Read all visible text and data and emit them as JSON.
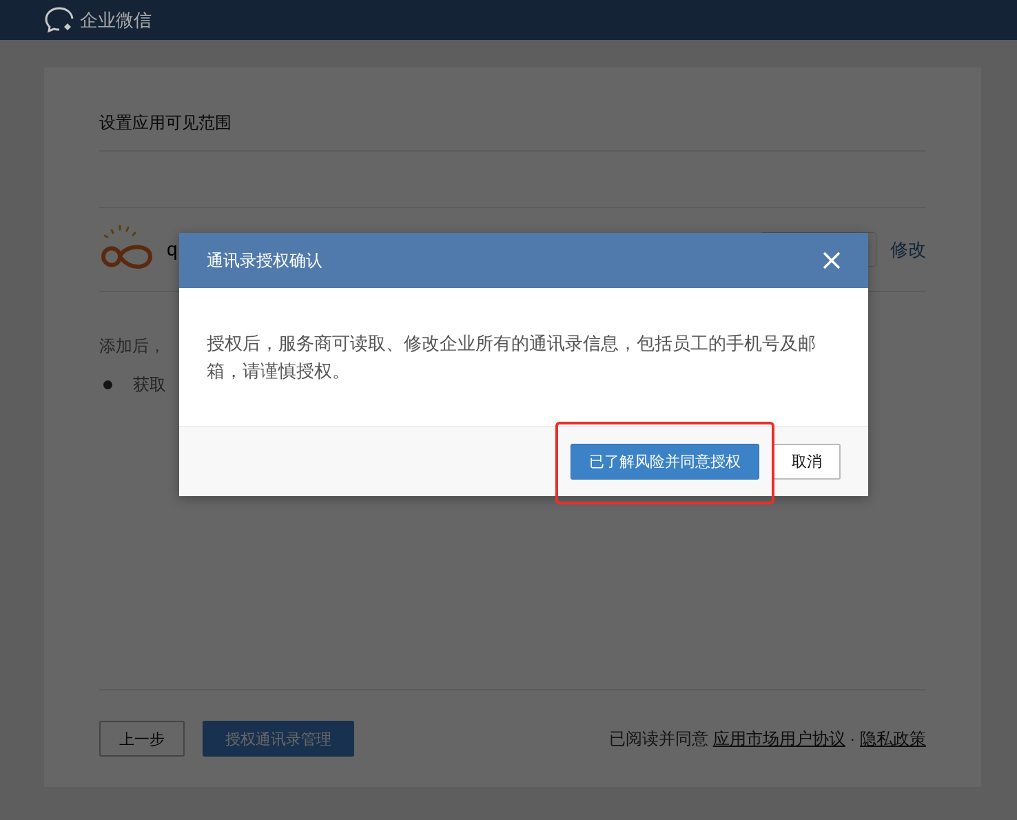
{
  "header": {
    "brand": "企业微信"
  },
  "page": {
    "title": "设置应用可见范围",
    "app": {
      "name": "q",
      "edit_link": "修改"
    },
    "note": "添加后，",
    "bullets": [
      "获取"
    ],
    "footer": {
      "back_button": "上一步",
      "primary_button": "授权通讯录管理",
      "agreement_prefix": "已阅读并同意",
      "links": [
        "应用市场用户协议",
        "隐私政策"
      ],
      "separator": "·"
    }
  },
  "dialog": {
    "title": "通讯录授权确认",
    "message": "授权后，服务商可读取、修改企业所有的通讯录信息，包括员工的手机号及邮箱，请谨慎授权。",
    "buttons": [
      {
        "label": "已了解风险并同意授权",
        "kind": "primary",
        "highlighted": true
      },
      {
        "label": "取消",
        "kind": "secondary",
        "highlighted": false
      }
    ]
  }
}
